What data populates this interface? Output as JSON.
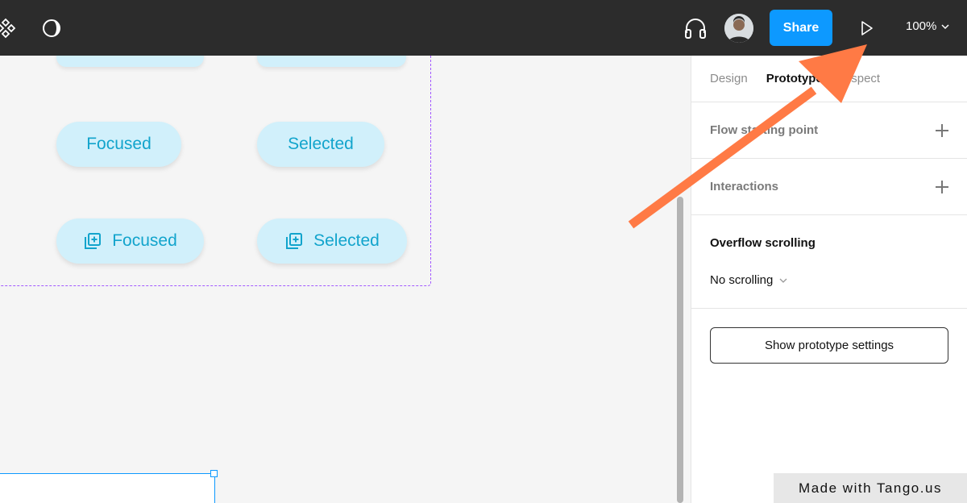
{
  "topbar": {
    "share_label": "Share",
    "zoom_label": "100%",
    "icons": [
      "components-icon",
      "theme-toggle-icon",
      "headphones-icon",
      "avatar",
      "play-icon",
      "chevron-down-icon"
    ]
  },
  "canvas": {
    "chips": [
      {
        "label": "Focused",
        "has_icon": false
      },
      {
        "label": "Selected",
        "has_icon": false
      },
      {
        "label": "Focused",
        "has_icon": true
      },
      {
        "label": "Selected",
        "has_icon": true
      }
    ]
  },
  "panel": {
    "tabs": [
      {
        "label": "Design",
        "active": false
      },
      {
        "label": "Prototype",
        "active": true
      },
      {
        "label": "Inspect",
        "active": false
      }
    ],
    "flow_label": "Flow starting point",
    "interactions_label": "Interactions",
    "overflow_label": "Overflow scrolling",
    "overflow_value": "No scrolling",
    "prototype_settings_label": "Show prototype settings"
  },
  "watermark": "Made with Tango.us",
  "colors": {
    "topbar_bg": "#2c2c2c",
    "share_blue": "#0d99ff",
    "chip_bg": "#d1f0fb",
    "chip_text": "#12a4cc",
    "frame_dash": "#a259ff",
    "annotation_arrow": "#ff7a45"
  }
}
